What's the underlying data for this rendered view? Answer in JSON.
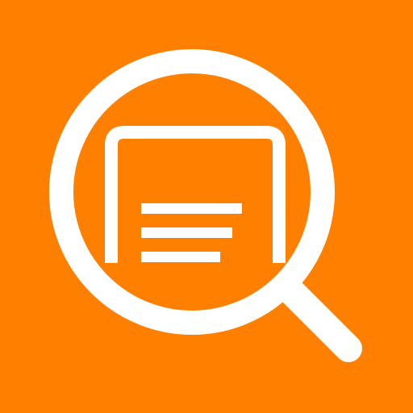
{
  "icon": {
    "name": "search-document-icon",
    "colors": {
      "background": "#FF7F00",
      "foreground": "#FFFFFF"
    },
    "document_text_lines": 3
  }
}
